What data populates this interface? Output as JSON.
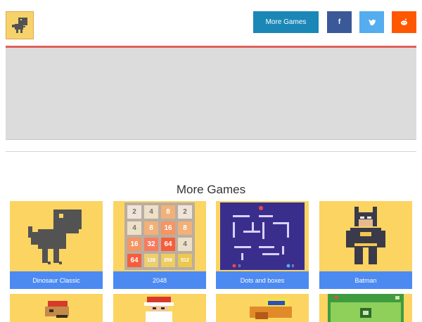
{
  "header": {
    "logo_icon": "dinosaur-icon",
    "more_games_label": "More Games",
    "social": [
      {
        "name": "facebook",
        "glyph": "f",
        "color": "#3b5998"
      },
      {
        "name": "twitter",
        "glyph": "t",
        "color": "#55acee"
      },
      {
        "name": "reddit",
        "glyph": "r",
        "color": "#ff5700"
      }
    ]
  },
  "section": {
    "title": "More Games"
  },
  "games": [
    {
      "label": "Dinosaur Classic"
    },
    {
      "label": "2048"
    },
    {
      "label": "Dots and boxes"
    },
    {
      "label": "Batman"
    }
  ],
  "board_2048": [
    "2",
    "4",
    "8",
    "2",
    "4",
    "8",
    "16",
    "8",
    "16",
    "32",
    "64",
    "4",
    "64",
    "128",
    "256",
    "512"
  ],
  "dots_scores": [
    "0",
    "0"
  ],
  "colors": {
    "accent_button": "#1b87b7",
    "card_label": "#4c8af2",
    "card_bg": "#fcd462",
    "header_line": "#e0605a"
  }
}
